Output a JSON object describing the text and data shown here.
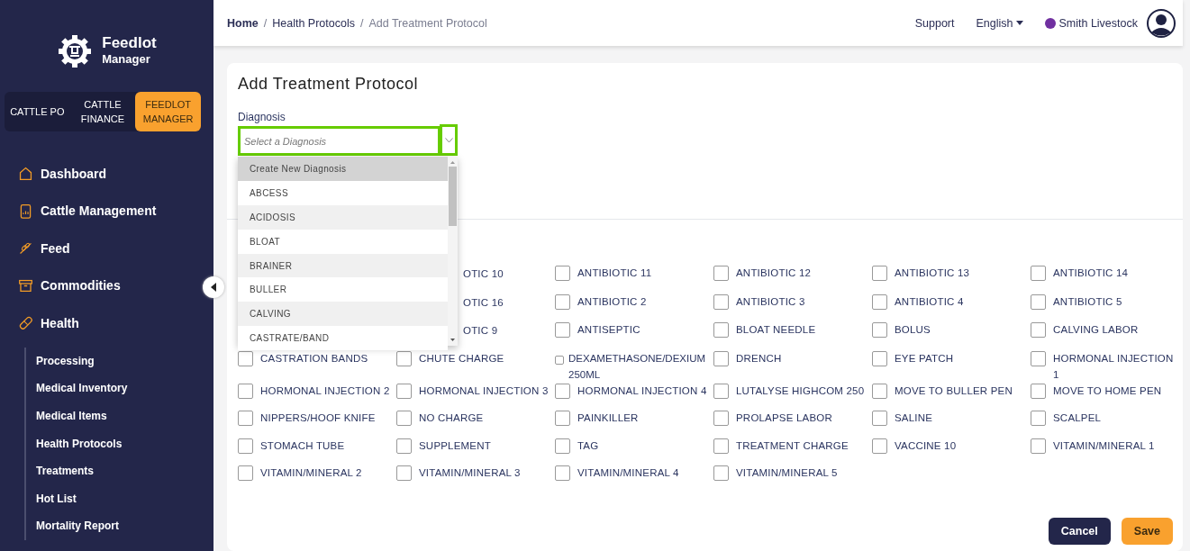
{
  "sidebar": {
    "logo": {
      "title": "Feedlot",
      "subtitle": "Manager"
    },
    "apps": [
      {
        "label": "CATTLE PO",
        "selected": false
      },
      {
        "label": "CATTLE FINANCE",
        "selected": false
      },
      {
        "label": "FEEDLOT MANAGER",
        "selected": true
      }
    ],
    "nav": [
      {
        "label": "Dashboard"
      },
      {
        "label": "Cattle Management"
      },
      {
        "label": "Feed"
      },
      {
        "label": "Commodities"
      },
      {
        "label": "Health",
        "children": [
          {
            "label": "Processing"
          },
          {
            "label": "Medical Inventory"
          },
          {
            "label": "Medical Items"
          },
          {
            "label": "Health Protocols"
          },
          {
            "label": "Treatments"
          },
          {
            "label": "Hot List"
          },
          {
            "label": "Mortality Report"
          }
        ]
      }
    ]
  },
  "topbar": {
    "breadcrumbs": [
      {
        "label": "Home",
        "separator": "/"
      },
      {
        "label": "Health Protocols",
        "separator": "/"
      },
      {
        "label": "Add Treatment Protocol"
      }
    ],
    "links": [
      "Support"
    ],
    "language": "English",
    "account": {
      "name": "Smith Livestock",
      "color": "#7030a0"
    }
  },
  "form": {
    "title": "Add Treatment Protocol",
    "diagnosis": {
      "label": "Diagnosis",
      "placeholder": "Select a Diagnosis",
      "expanded": true,
      "options": [
        {
          "label": "Create New Diagnosis",
          "selected": true
        },
        {
          "label": "ABCESS",
          "selected": false
        },
        {
          "label": "ACIDOSIS",
          "selected": false
        },
        {
          "label": "BLOAT",
          "selected": false
        },
        {
          "label": "BRAINER",
          "selected": false
        },
        {
          "label": "BULLER",
          "selected": false
        },
        {
          "label": "CALVING",
          "selected": false
        },
        {
          "label": "CASTRATE/BAND",
          "selected": false
        }
      ]
    },
    "items": [
      {
        "label": "OTIC 10",
        "kind": "partial"
      },
      {
        "label": "ANTIBIOTIC 11",
        "checked": false
      },
      {
        "label": "ANTIBIOTIC 12",
        "checked": false
      },
      {
        "label": "ANTIBIOTIC 13",
        "checked": false
      },
      {
        "label": "ANTIBIOTIC 14",
        "checked": false
      },
      {
        "label": "OTIC 16",
        "kind": "partial"
      },
      {
        "label": "ANTIBIOTIC 2",
        "checked": false
      },
      {
        "label": "ANTIBIOTIC 3",
        "checked": false
      },
      {
        "label": "ANTIBIOTIC 4",
        "checked": false
      },
      {
        "label": "ANTIBIOTIC 5",
        "checked": false
      },
      {
        "label": "OTIC 9",
        "kind": "partial"
      },
      {
        "label": "ANTISEPTIC",
        "checked": false
      },
      {
        "label": "BLOAT NEEDLE",
        "checked": false
      },
      {
        "label": "BOLUS",
        "checked": false
      },
      {
        "label": "CALVING LABOR",
        "checked": false
      },
      {
        "label": "CASTRATION BANDS",
        "checked": false
      },
      {
        "label": "CHUTE CHARGE",
        "checked": false
      },
      {
        "label": "DEXAMETHASONE/DEXIUM 250ML",
        "checked": false,
        "kind": "compact"
      },
      {
        "label": "DRENCH",
        "checked": false
      },
      {
        "label": "EYE PATCH",
        "checked": false
      },
      {
        "label": "HORMONAL INJECTION 1",
        "checked": false
      },
      {
        "label": "HORMONAL INJECTION 2",
        "checked": false
      },
      {
        "label": "HORMONAL INJECTION 3",
        "checked": false
      },
      {
        "label": "HORMONAL INJECTION 4",
        "checked": false
      },
      {
        "label": "LUTALYSE HIGHCOM 250",
        "checked": false
      },
      {
        "label": "MOVE TO BULLER PEN",
        "checked": false
      },
      {
        "label": "MOVE TO HOME PEN",
        "checked": false
      },
      {
        "label": "NIPPERS/HOOF KNIFE",
        "checked": false
      },
      {
        "label": "NO CHARGE",
        "checked": false
      },
      {
        "label": "PAINKILLER",
        "checked": false
      },
      {
        "label": "PROLAPSE LABOR",
        "checked": false
      },
      {
        "label": "SALINE",
        "checked": false
      },
      {
        "label": "SCALPEL",
        "checked": false
      },
      {
        "label": "STOMACH TUBE",
        "checked": false
      },
      {
        "label": "SUPPLEMENT",
        "checked": false
      },
      {
        "label": "TAG",
        "checked": false
      },
      {
        "label": "TREATMENT CHARGE",
        "checked": false
      },
      {
        "label": "VACCINE 10",
        "checked": false
      },
      {
        "label": "VITAMIN/MINERAL 1",
        "checked": false
      },
      {
        "label": "VITAMIN/MINERAL 2",
        "checked": false
      },
      {
        "label": "VITAMIN/MINERAL 3",
        "checked": false
      },
      {
        "label": "VITAMIN/MINERAL 4",
        "checked": false
      },
      {
        "label": "VITAMIN/MINERAL 5",
        "checked": false
      }
    ],
    "buttons": [
      {
        "label": "Cancel",
        "kind": "secondary"
      },
      {
        "label": "Save",
        "kind": "primary"
      }
    ]
  }
}
